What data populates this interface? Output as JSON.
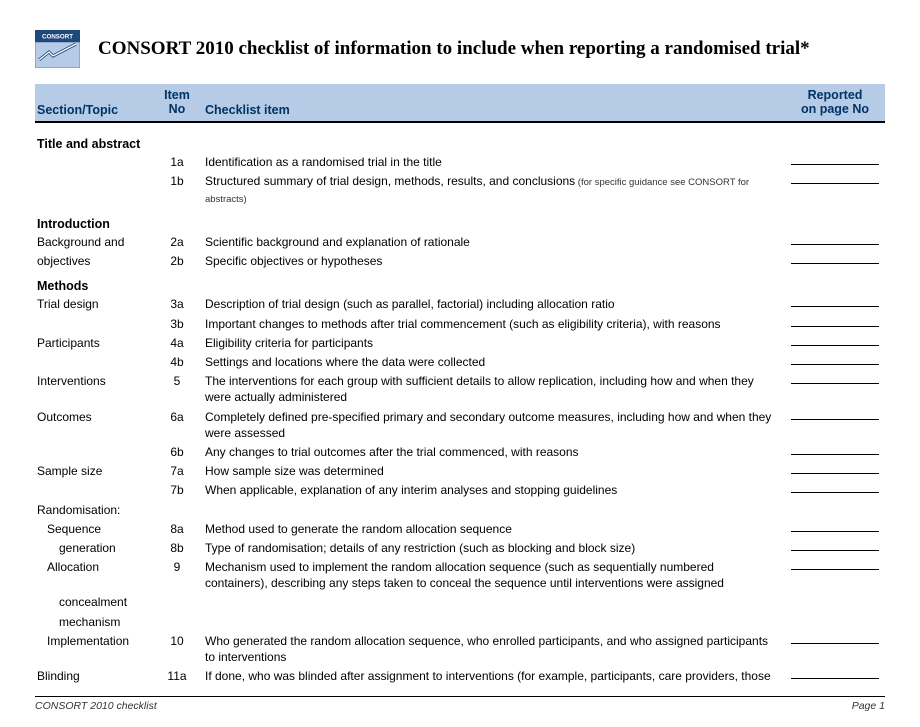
{
  "title": "CONSORT 2010 checklist of information to include when reporting a randomised trial*",
  "logo": {
    "topText": "CONSORT",
    "badgeColor": "#1f497d",
    "accentColor": "#b5cbe6"
  },
  "columns": {
    "section": "Section/Topic",
    "itemNo_line1": "Item",
    "itemNo_line2": "No",
    "checklist": "Checklist item",
    "report_line1": "Reported",
    "report_line2": "on page No"
  },
  "footer": {
    "left": "CONSORT 2010 checklist",
    "right": "Page 1"
  },
  "sections": [
    {
      "heading": "Title and abstract",
      "rows": [
        {
          "topic": "",
          "item": "1a",
          "desc": "Identification as a randomised trial in the title",
          "blank": true
        },
        {
          "topic": "",
          "item": "1b",
          "desc": "Structured summary of trial design, methods, results, and conclusions",
          "footnote": "(for specific guidance see CONSORT for abstracts)",
          "blank": true
        }
      ]
    },
    {
      "heading": "Introduction",
      "rows": [
        {
          "topic": "Background and",
          "item": "2a",
          "desc": "Scientific background and explanation of rationale",
          "blank": true
        },
        {
          "topic": "objectives",
          "item": "2b",
          "desc": "Specific objectives or hypotheses",
          "blank": true
        }
      ]
    },
    {
      "heading": "Methods",
      "rows": [
        {
          "topic": "Trial design",
          "item": "3a",
          "desc": "Description of trial design (such as parallel, factorial) including allocation ratio",
          "blank": true
        },
        {
          "topic": "",
          "item": "3b",
          "desc": "Important changes to methods after trial commencement (such as eligibility criteria), with reasons",
          "blank": true
        },
        {
          "topic": "Participants",
          "item": "4a",
          "desc": "Eligibility criteria for participants",
          "blank": true
        },
        {
          "topic": "",
          "item": "4b",
          "desc": "Settings and locations where the data were collected",
          "blank": true
        },
        {
          "topic": "Interventions",
          "item": "5",
          "desc": "The interventions for each group with sufficient details to allow replication, including how and when they were actually administered",
          "blank": true
        },
        {
          "topic": "Outcomes",
          "item": "6a",
          "desc": "Completely defined pre-specified primary and secondary outcome measures, including how and when they were assessed",
          "blank": true
        },
        {
          "topic": "",
          "item": "6b",
          "desc": "Any changes to trial outcomes after the trial commenced, with reasons",
          "blank": true
        },
        {
          "topic": "Sample size",
          "item": "7a",
          "desc": "How sample size was determined",
          "blank": true
        },
        {
          "topic": "",
          "item": "7b",
          "desc": "When applicable, explanation of any interim analyses and stopping guidelines",
          "blank": true
        },
        {
          "topic": "Randomisation:",
          "item": "",
          "desc": "",
          "blank": false
        },
        {
          "topic": "Sequence",
          "indent": 1,
          "item": "8a",
          "desc": "Method used to generate the random allocation sequence",
          "blank": true
        },
        {
          "topic": "generation",
          "indent": 2,
          "item": "8b",
          "desc": "Type of randomisation; details of any restriction (such as blocking and block size)",
          "blank": true
        },
        {
          "topic": "Allocation",
          "indent": 1,
          "item": "9",
          "desc": "Mechanism used to implement the random allocation sequence (such as sequentially numbered containers), describing any steps taken to conceal the sequence until interventions were assigned",
          "blank": true
        },
        {
          "topic": "concealment",
          "indent": 2,
          "item": "",
          "desc": "",
          "blank": false
        },
        {
          "topic": "mechanism",
          "indent": 2,
          "item": "",
          "desc": "",
          "blank": false
        },
        {
          "topic": "Implementation",
          "indent": 1,
          "item": "10",
          "desc": "Who generated the random allocation sequence, who enrolled participants, and who assigned participants to interventions",
          "blank": true
        },
        {
          "topic": "Blinding",
          "item": "11a",
          "desc": "If done, who was blinded after assignment to interventions (for example, participants, care providers, those",
          "blank": true
        }
      ]
    }
  ]
}
